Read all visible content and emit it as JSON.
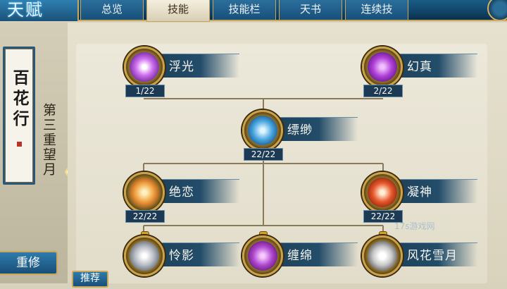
{
  "header": {
    "title": "天赋",
    "tabs": [
      {
        "label": "总览"
      },
      {
        "label": "技能",
        "active": true
      },
      {
        "label": "技能栏"
      },
      {
        "label": "天书"
      },
      {
        "label": "连续技"
      }
    ]
  },
  "sidebar": {
    "scroll_title": "百花行",
    "stage": "第三重望月",
    "reset_label": "重修",
    "recommend_label": "推荐"
  },
  "skills": [
    {
      "name": "浮光",
      "level": "1/22",
      "color": "#c25fe0"
    },
    {
      "name": "幻真",
      "level": "2/22",
      "color": "#b34fd8"
    },
    {
      "name": "缥缈",
      "level": "22/22",
      "color": "#4aa8e0"
    },
    {
      "name": "绝恋",
      "level": "22/22",
      "color": "#f0a040"
    },
    {
      "name": "凝神",
      "level": "22/22",
      "color": "#e8582a"
    },
    {
      "name": "怜影",
      "level": "",
      "color": "#b8bcc4"
    },
    {
      "name": "缠绵",
      "level": "",
      "color": "#b048d0"
    },
    {
      "name": "风花雪月",
      "level": "",
      "color": "#c8c8c8"
    }
  ],
  "watermark": "17s游戏网"
}
